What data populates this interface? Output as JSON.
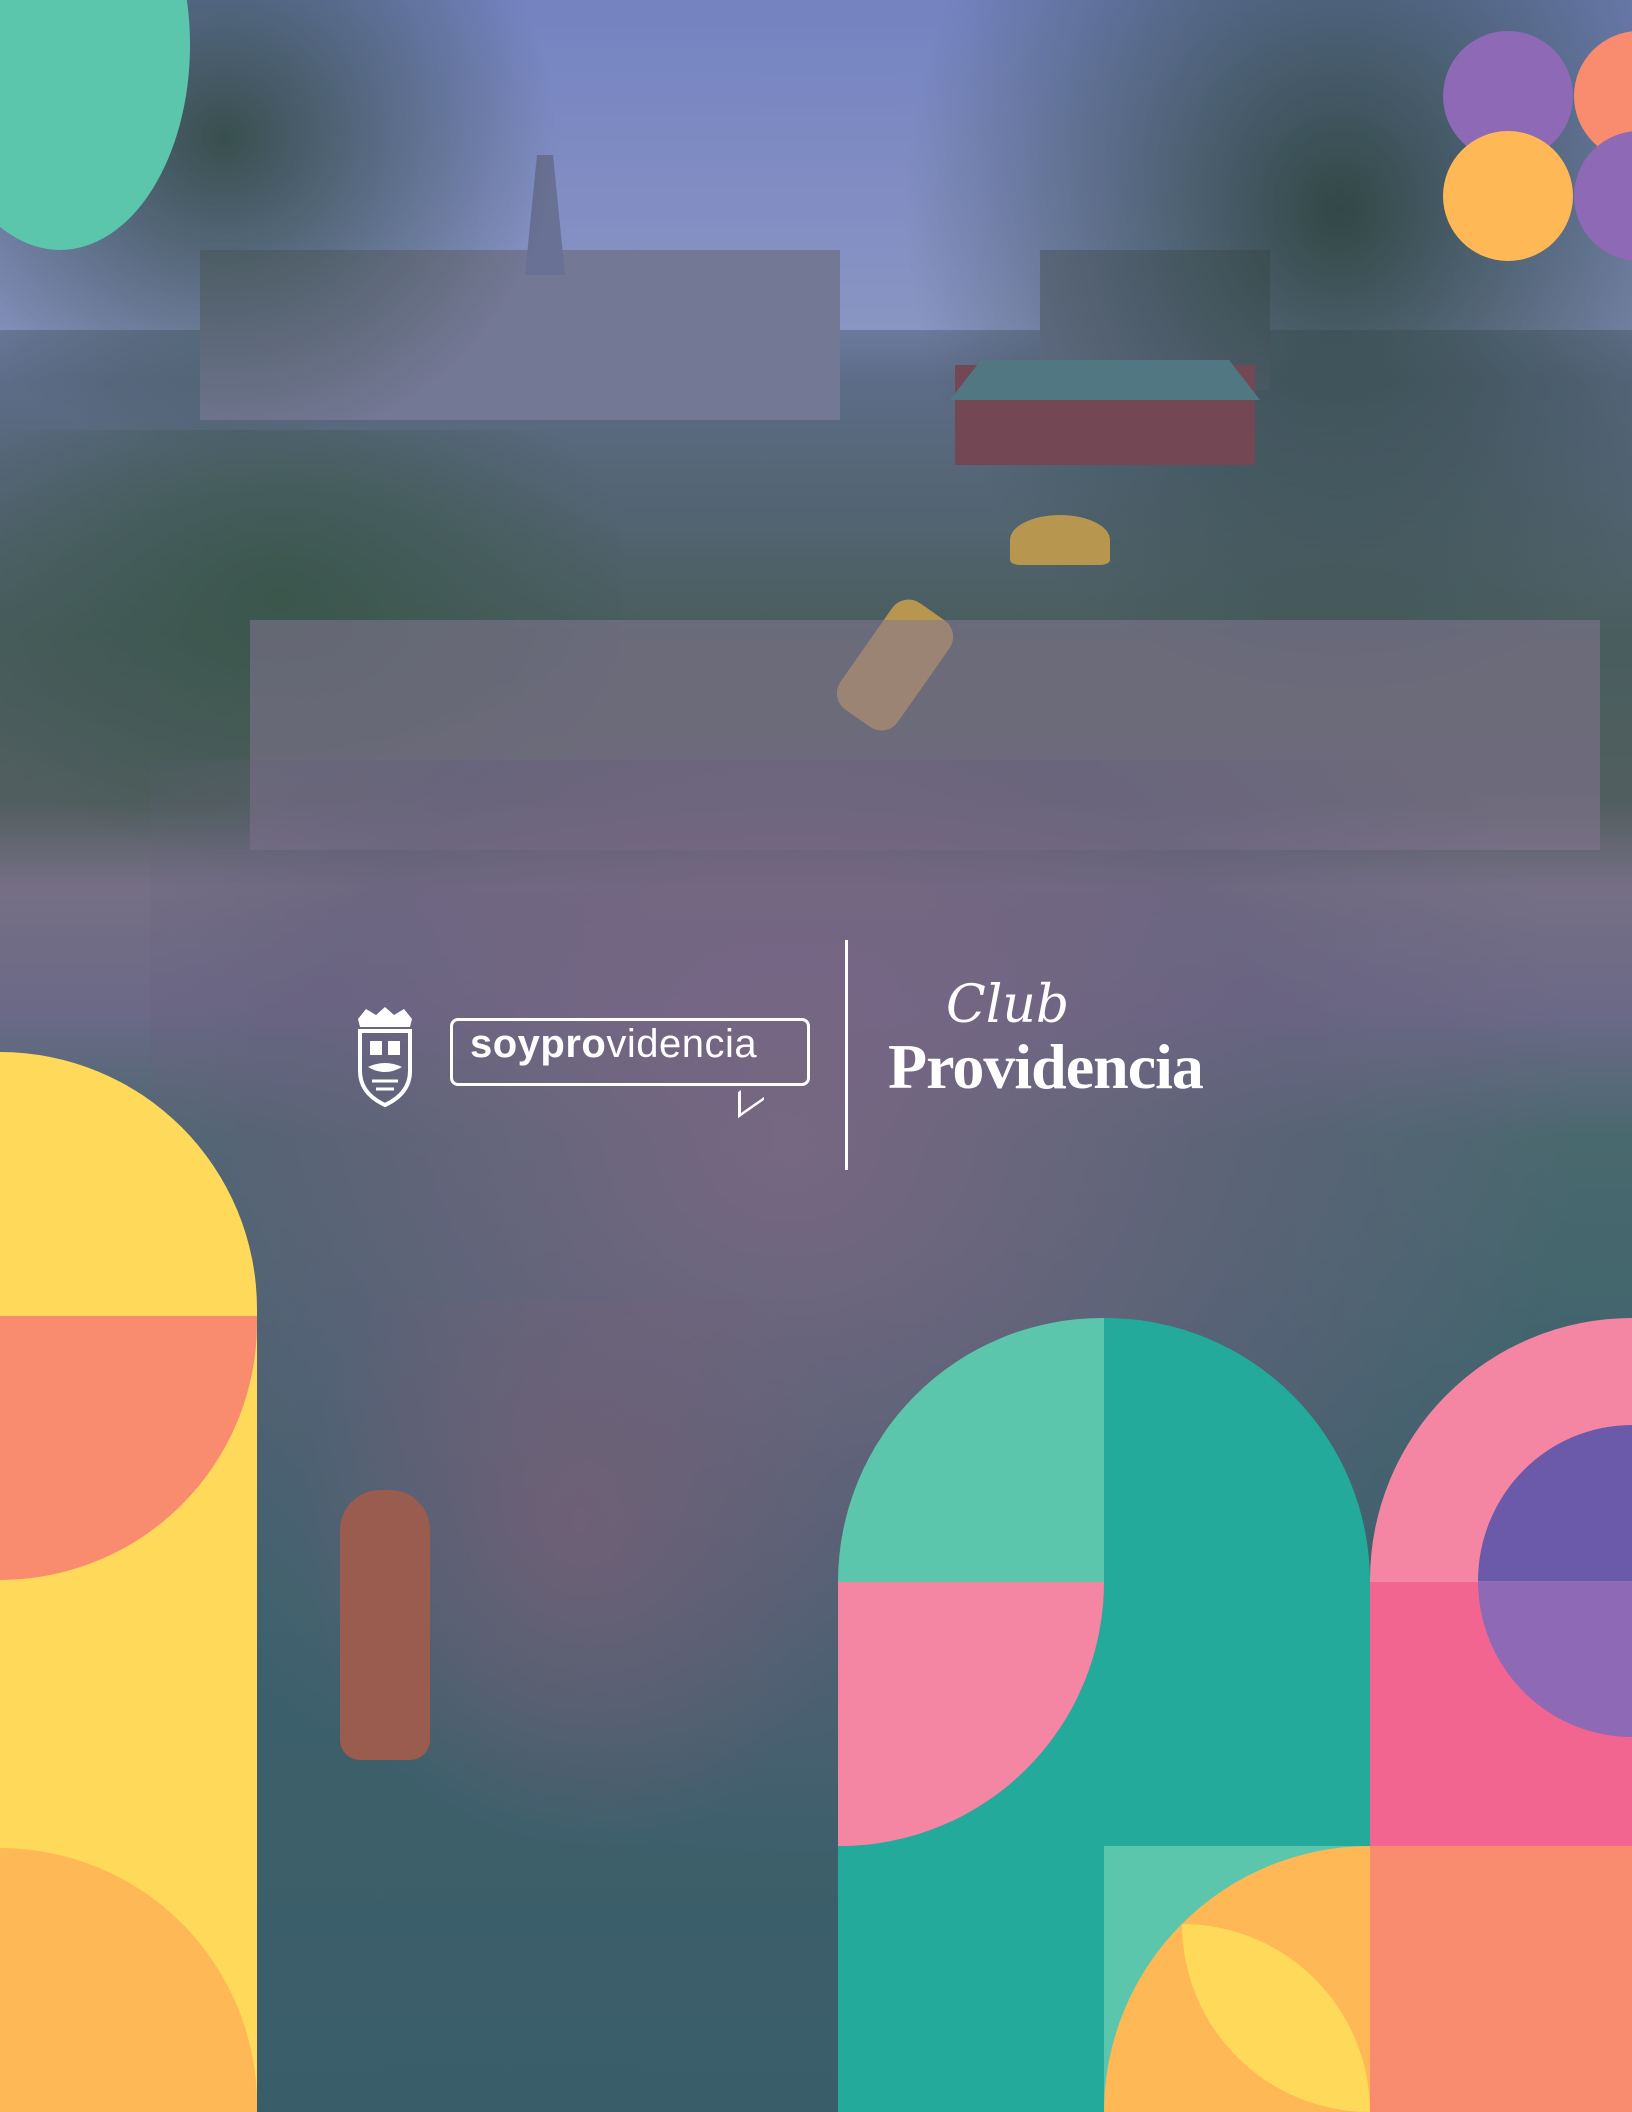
{
  "poster": {
    "photo": {
      "subject": "group-photo-crowd",
      "overlay_color": "#383e8c"
    },
    "logos": {
      "municipal_crest": "municipal-crest-icon",
      "soy_bold": "soypro",
      "soy_light": "videncia",
      "club_script": "Club",
      "club_main": "Providencia"
    },
    "colors": {
      "teal": "#5cc6ad",
      "teal_dark": "#23aa9b",
      "yellow": "#ffd95a",
      "orange": "#f98c6e",
      "amber": "#ffb855",
      "pink": "#f486a3",
      "pink_dark": "#f26591",
      "purple": "#8e69b6",
      "violet": "#6a5aa9"
    }
  }
}
